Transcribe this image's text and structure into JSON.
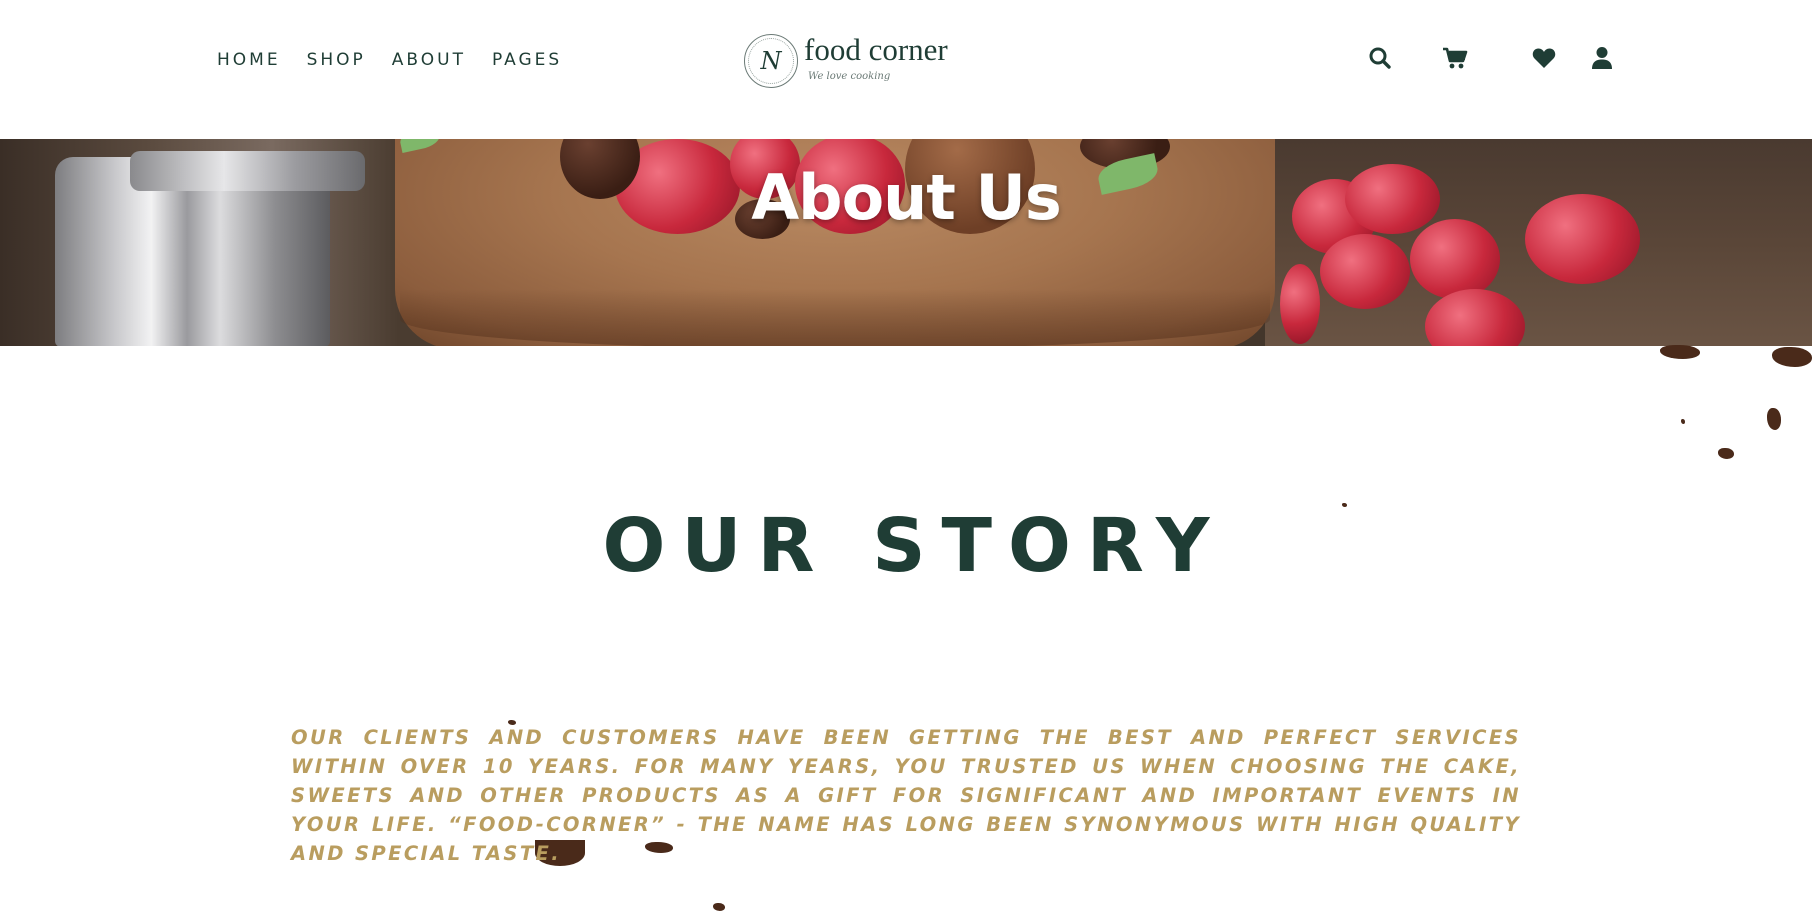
{
  "nav": {
    "items": [
      {
        "label": "HOME"
      },
      {
        "label": "SHOP"
      },
      {
        "label": "ABOUT"
      },
      {
        "label": "PAGES"
      }
    ]
  },
  "logo": {
    "monogram": "N",
    "name": "food corner",
    "tagline": "We love cooking"
  },
  "icons": {
    "search": "search-icon",
    "cart": "cart-icon",
    "wishlist": "heart-icon",
    "account": "user-icon"
  },
  "banner": {
    "title": "About Us"
  },
  "story": {
    "title": "OUR STORY",
    "text": "OUR CLIENTS AND CUSTOMERS HAVE BEEN GETTING THE BEST AND PERFECT SERVICES WITHIN OVER 10 YEARS. FOR MANY YEARS, YOU TRUSTED US WHEN CHOOSING THE CAKE, SWEETS AND OTHER PRODUCTS AS A GIFT FOR SIGNIFICANT AND IMPORTANT EVENTS IN YOUR LIFE. “FOOD-CORNER” - THE NAME HAS LONG BEEN SYNONYMOUS WITH HIGH QUALITY AND SPECIAL TASTE."
  },
  "colors": {
    "primary": "#1f3d35",
    "accent": "#b99d5f",
    "banner_text": "#ffffff"
  }
}
